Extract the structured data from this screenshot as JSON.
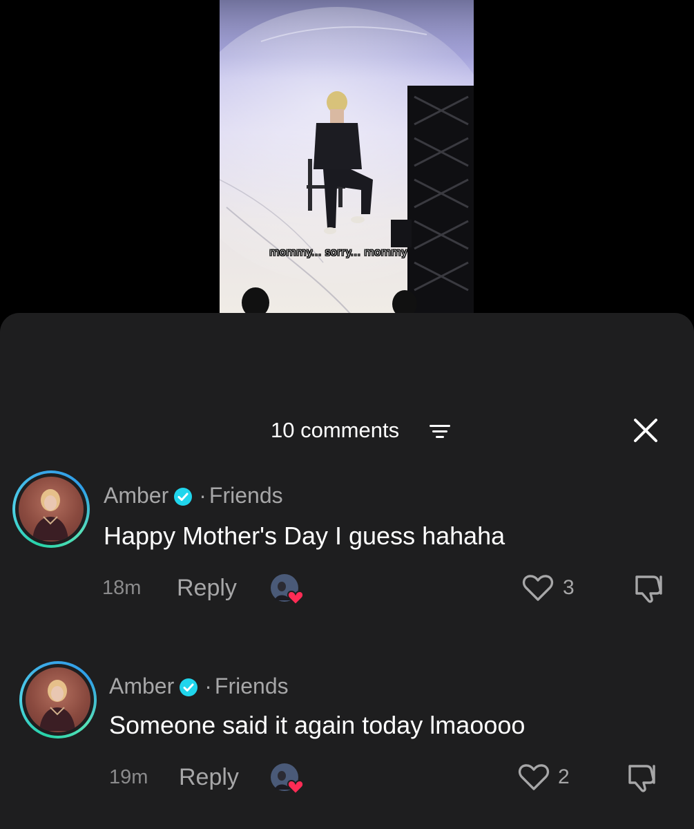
{
  "video": {
    "caption": "mommy... sorry... mommy"
  },
  "sheet": {
    "title": "10 comments",
    "sort_icon": "sort-lines-icon",
    "close_icon": "close-x-icon"
  },
  "comments": [
    {
      "username": "Amber",
      "relation": "Friends",
      "text": "Happy Mother's Day I guess hahaha",
      "time": "18m",
      "reply_label": "Reply",
      "likes": "3"
    },
    {
      "username": "Amber",
      "relation": "Friends",
      "text": "Someone said it again today lmaoooo",
      "time": "19m",
      "reply_label": "Reply",
      "likes": "2"
    }
  ],
  "colors": {
    "sheet_bg": "#1e1e1f",
    "verified": "#20d5ec",
    "heart_badge": "#fe2c55",
    "avatar_ring": "#27d3a8"
  }
}
